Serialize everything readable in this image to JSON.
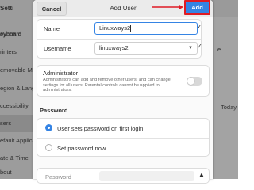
{
  "background": {
    "sidebar_title": "Setti",
    "sidebar_items": [
      {
        "label": "eyboard",
        "active": false
      },
      {
        "label": "rinters",
        "active": false
      },
      {
        "label": "emovable Med",
        "active": false
      },
      {
        "label": "olor",
        "active": false
      },
      {
        "label": "egion & Langu",
        "active": false
      },
      {
        "label": "ccessibility",
        "active": false
      },
      {
        "label": "sers",
        "active": true
      },
      {
        "label": "efault Applica",
        "active": false
      },
      {
        "label": "ate & Time",
        "active": false
      },
      {
        "label": "bout",
        "active": false
      }
    ],
    "right_texts": [
      "e",
      "Today,"
    ]
  },
  "dialog": {
    "title": "Add User",
    "cancel_label": "Cancel",
    "add_label": "Add",
    "name_label": "Name",
    "name_value": "Linuxways2",
    "username_label": "Username",
    "username_value": "linuxways2",
    "admin_title": "Administrator",
    "admin_desc": "Administrators can add and remove other users, and can change settings for all users. Parental controls cannot be applied to administrators.",
    "admin_toggle_on": false,
    "password_section": "Password",
    "password_options": [
      {
        "label": "User sets password on first login",
        "selected": true
      },
      {
        "label": "Set password now",
        "selected": false
      }
    ],
    "password_field_label": "Password"
  },
  "colors": {
    "accent": "#3584e4",
    "highlight_outline": "#e01b24",
    "arrow": "#e01b24"
  }
}
